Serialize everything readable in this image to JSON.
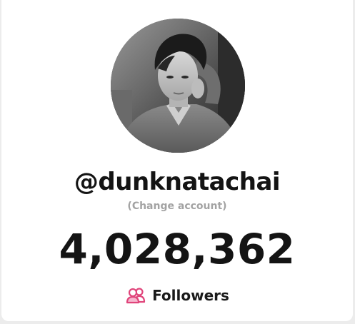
{
  "profile": {
    "username": "@dunknatachai",
    "change_account_label": "(Change account)",
    "avatar_icon": "user-avatar"
  },
  "stats": {
    "followers_count": "4,028,362",
    "followers_label": "Followers",
    "followers_icon": "users-icon"
  },
  "colors": {
    "accent_icon": "#e0457b",
    "text": "#141414",
    "muted": "#a3a3a3"
  }
}
